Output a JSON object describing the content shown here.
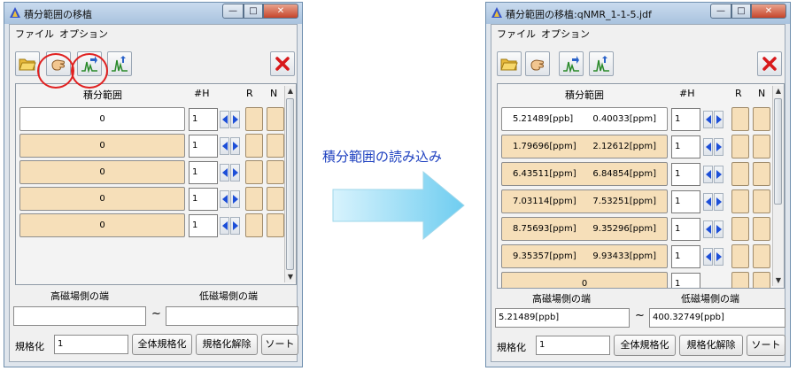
{
  "left": {
    "title": "積分範囲の移植",
    "menu": [
      "ファイル",
      "オプション"
    ],
    "close_label": "x",
    "headers": {
      "range": "積分範囲",
      "h": "#H",
      "r": "R",
      "n": "N"
    },
    "rows": [
      {
        "value": "0",
        "h": "1"
      },
      {
        "value": "0",
        "h": "1"
      },
      {
        "value": "0",
        "h": "1"
      },
      {
        "value": "0",
        "h": "1"
      },
      {
        "value": "0",
        "h": "1"
      }
    ],
    "edge_high": "高磁場側の端",
    "edge_low": "低磁場側の端",
    "field_high": "",
    "field_low": "",
    "tilde": "~",
    "normalize_label": "規格化",
    "normalize_value": "1",
    "btn_normalize_all": "全体規格化",
    "btn_unnormalize": "規格化解除",
    "btn_sort": "ソート"
  },
  "caption": "積分範囲の読み込み",
  "right": {
    "title": "積分範囲の移植:qNMR_1-1-5.jdf",
    "menu": [
      "ファイル",
      "オプション"
    ],
    "close_label": "x",
    "headers": {
      "range": "積分範囲",
      "h": "#H",
      "r": "R",
      "n": "N"
    },
    "rows": [
      {
        "v1": "5.21489[ppb]",
        "v2": "0.40033[ppm]",
        "h": "1"
      },
      {
        "v1": "1.79696[ppm]",
        "v2": "2.12612[ppm]",
        "h": "1"
      },
      {
        "v1": "6.43511[ppm]",
        "v2": "6.84854[ppm]",
        "h": "1"
      },
      {
        "v1": "7.03114[ppm]",
        "v2": "7.53251[ppm]",
        "h": "1"
      },
      {
        "v1": "8.75693[ppm]",
        "v2": "9.35296[ppm]",
        "h": "1"
      },
      {
        "v1": "9.35357[ppm]",
        "v2": "9.93433[ppm]",
        "h": "1"
      }
    ],
    "partial_row": {
      "value": "0",
      "h": "1"
    },
    "edge_high": "高磁場側の端",
    "edge_low": "低磁場側の端",
    "field_high": "5.21489[ppb]",
    "field_low": "400.32749[ppb]",
    "tilde": "~",
    "normalize_label": "規格化",
    "normalize_value": "1",
    "btn_normalize_all": "全体規格化",
    "btn_unnormalize": "規格化解除",
    "btn_sort": "ソート"
  },
  "icons": [
    "app-icon",
    "folder-open-icon",
    "hand-pick-icon",
    "import-peaks-icon",
    "export-peaks-icon",
    "close-x-icon",
    "arrow-left-icon",
    "arrow-right-icon"
  ],
  "colors": {
    "row_fill": "#f6dfb9",
    "highlight_ring": "#e02020",
    "arrow_fill": "#8fd6f2",
    "caption": "#1c3fbf"
  }
}
